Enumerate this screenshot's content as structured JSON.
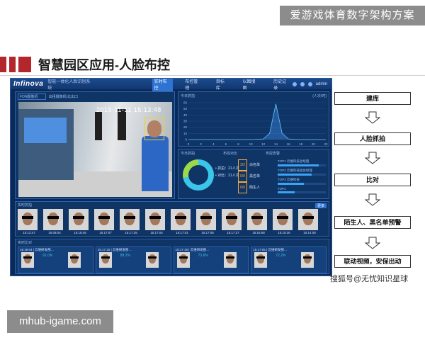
{
  "watermark_top": "爱游戏体育数字架构方案",
  "slide_title": "智慧园区应用-人脸布控",
  "app": {
    "logo": "Infinova",
    "system_name": "智能一体化人脸识别系统",
    "tabs": [
      "实时布控",
      "布控管理",
      "目标库",
      "以图搜图",
      "历史记录"
    ],
    "active_tab": 0,
    "user": "admin"
  },
  "video": {
    "camera_select": "FON摄像机",
    "camera_label": "出租摄像机/北出口",
    "timestamp": "2019-11-11 15:13:48"
  },
  "chart_panel": {
    "title": "今日抓拍",
    "unit": "(人次/时)",
    "y_ticks": [
      "60",
      "50",
      "40",
      "30",
      "20",
      "10",
      "0"
    ],
    "x_ticks": [
      "0",
      "2",
      "4",
      "6",
      "8",
      "10",
      "12",
      "14",
      "16",
      "18",
      "20",
      "22"
    ]
  },
  "chart_data": {
    "type": "area",
    "x": [
      0,
      2,
      4,
      6,
      8,
      10,
      12,
      13,
      14,
      15,
      16,
      18,
      20,
      22
    ],
    "y": [
      0,
      0,
      0,
      0,
      0,
      0,
      1,
      10,
      58,
      10,
      1,
      0,
      0,
      0
    ],
    "ylim": [
      0,
      60
    ]
  },
  "stats": {
    "title": "今日抓拍",
    "col2": "布控对比",
    "col3": "布控告警",
    "legend": [
      "• 抓拍：21人次",
      "• 对比：21人次"
    ],
    "badges": [
      {
        "count": "3/2",
        "label": "白名单"
      },
      {
        "count": "0/0",
        "label": "黑名单"
      },
      {
        "count": "0/0",
        "label": "陌生人"
      }
    ],
    "progress": [
      {
        "label": "TOP1  云维科技总经理",
        "value": 0.85
      },
      {
        "label": "TOP2  云维科技副总经理",
        "value": 0.7
      },
      {
        "label": "TOP3  云维科技",
        "value": 0.55
      },
      {
        "label": "TOP4",
        "value": 0.35
      }
    ]
  },
  "capture": {
    "title": "实时抓拍",
    "more": "更多",
    "times": [
      "15:12:47",
      "15:08:04",
      "15:18:45",
      "15:17:07",
      "15:17:35",
      "15:17:04",
      "15:17:01",
      "15:17:08",
      "15:17:27",
      "15:16:58",
      "15:15:36",
      "15:14:08"
    ]
  },
  "compare": {
    "title": "实时比对",
    "cards": [
      {
        "time": "15:18:04 | 云维研发部…",
        "pct": "91.0%"
      },
      {
        "time": "15:17:15 | 云维研发部…",
        "pct": "88.2%"
      },
      {
        "time": "15:17:18 | 云维研发部…",
        "pct": "73.6%"
      },
      {
        "time": "15:17:05 | 云维研发部…",
        "pct": "72.2%"
      }
    ]
  },
  "flow": [
    "建库",
    "人脸抓拍",
    "比对",
    "陌生人、黑名单预警",
    "联动视频，安保出动"
  ],
  "source": "搜狐号@无忧知识星球",
  "watermark_bottom": "mhub-igame.com"
}
